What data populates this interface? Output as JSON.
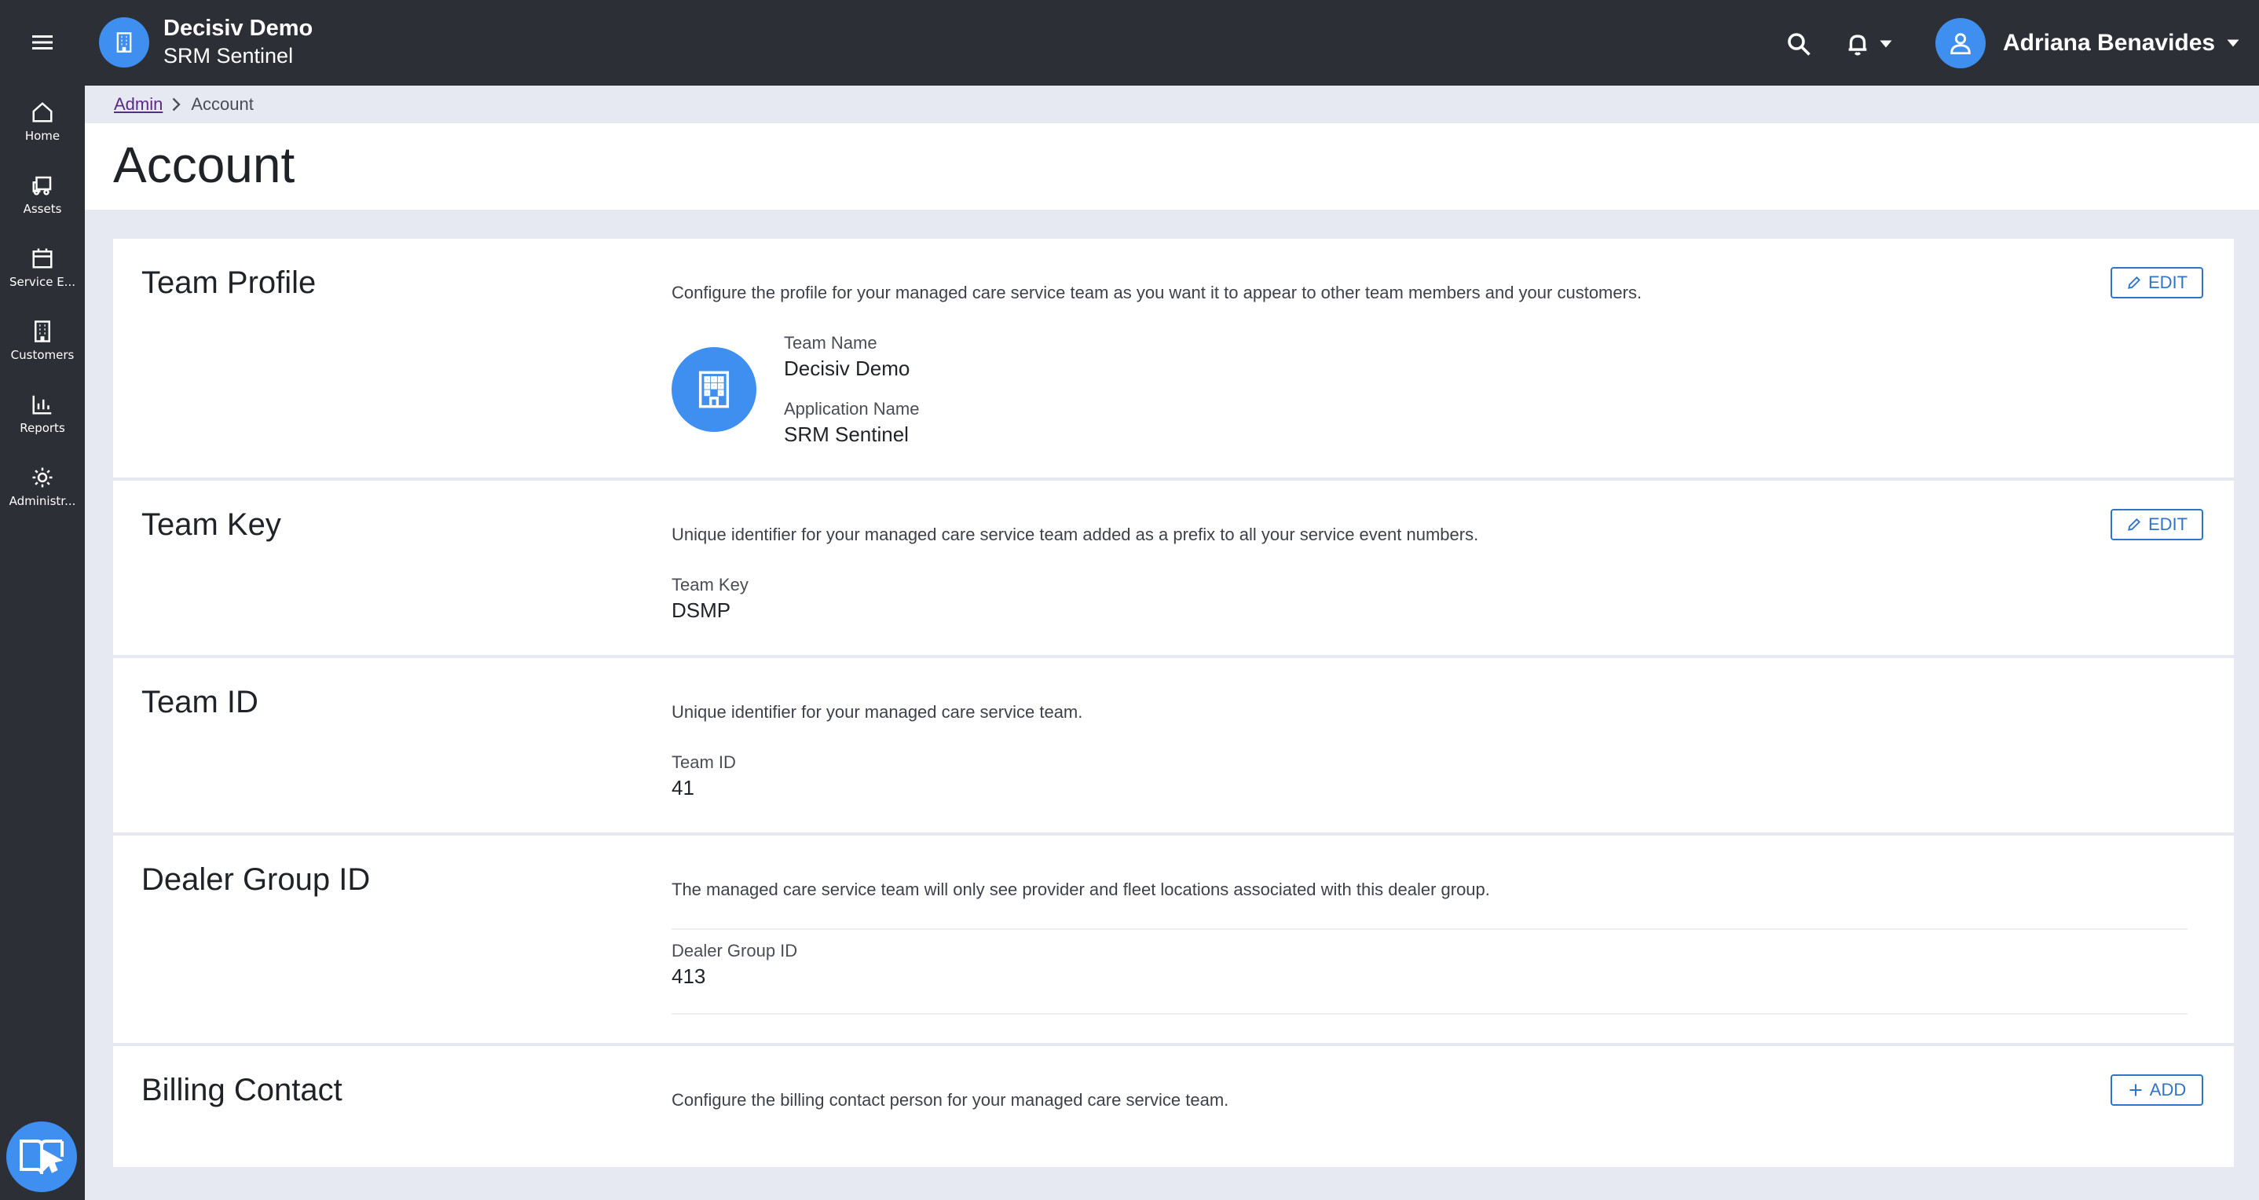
{
  "header": {
    "team_name": "Decisiv Demo",
    "app_name": "SRM Sentinel",
    "user_name": "Adriana Benavides",
    "icons": [
      "menu-icon",
      "building-icon",
      "search-icon",
      "bell-icon",
      "chevron-down-icon",
      "user-icon"
    ]
  },
  "sidebar": {
    "items": [
      {
        "label": "Home",
        "icon": "home-icon"
      },
      {
        "label": "Assets",
        "icon": "truck-icon"
      },
      {
        "label": "Service E...",
        "icon": "calendar-icon"
      },
      {
        "label": "Customers",
        "icon": "building-icon"
      },
      {
        "label": "Reports",
        "icon": "bar-chart-icon"
      },
      {
        "label": "Administr...",
        "icon": "gear-icon"
      }
    ],
    "help_icon": "book-pointer-icon"
  },
  "breadcrumb": {
    "parent": "Admin",
    "current": "Account"
  },
  "page": {
    "title": "Account"
  },
  "sections": {
    "team_profile": {
      "title": "Team Profile",
      "description": "Configure the profile for your managed care service team as you want it to appear to other team members and your customers.",
      "fields": [
        {
          "label": "Team Name",
          "value": "Decisiv Demo"
        },
        {
          "label": "Application Name",
          "value": "SRM Sentinel"
        }
      ],
      "action_label": "EDIT"
    },
    "team_key": {
      "title": "Team Key",
      "description": "Unique identifier for your managed care service team added as a prefix to all your service event numbers.",
      "fields": [
        {
          "label": "Team Key",
          "value": "DSMP"
        }
      ],
      "action_label": "EDIT"
    },
    "team_id": {
      "title": "Team ID",
      "description": "Unique identifier for your managed care service team.",
      "fields": [
        {
          "label": "Team ID",
          "value": "41"
        }
      ]
    },
    "dealer_group": {
      "title": "Dealer Group ID",
      "description": "The managed care service team will only see provider and fleet locations associated with this dealer group.",
      "fields": [
        {
          "label": "Dealer Group ID",
          "value": "413"
        }
      ]
    },
    "billing_contact": {
      "title": "Billing Contact",
      "description": "Configure the billing contact person for your managed care service team.",
      "action_label": "ADD"
    }
  },
  "colors": {
    "sidebar_bg": "#2d2f37",
    "accent_blue": "#3f8ff0",
    "button_blue": "#2f74c9",
    "page_bg": "#e6e9f1",
    "link_purple": "#5b2a86"
  }
}
